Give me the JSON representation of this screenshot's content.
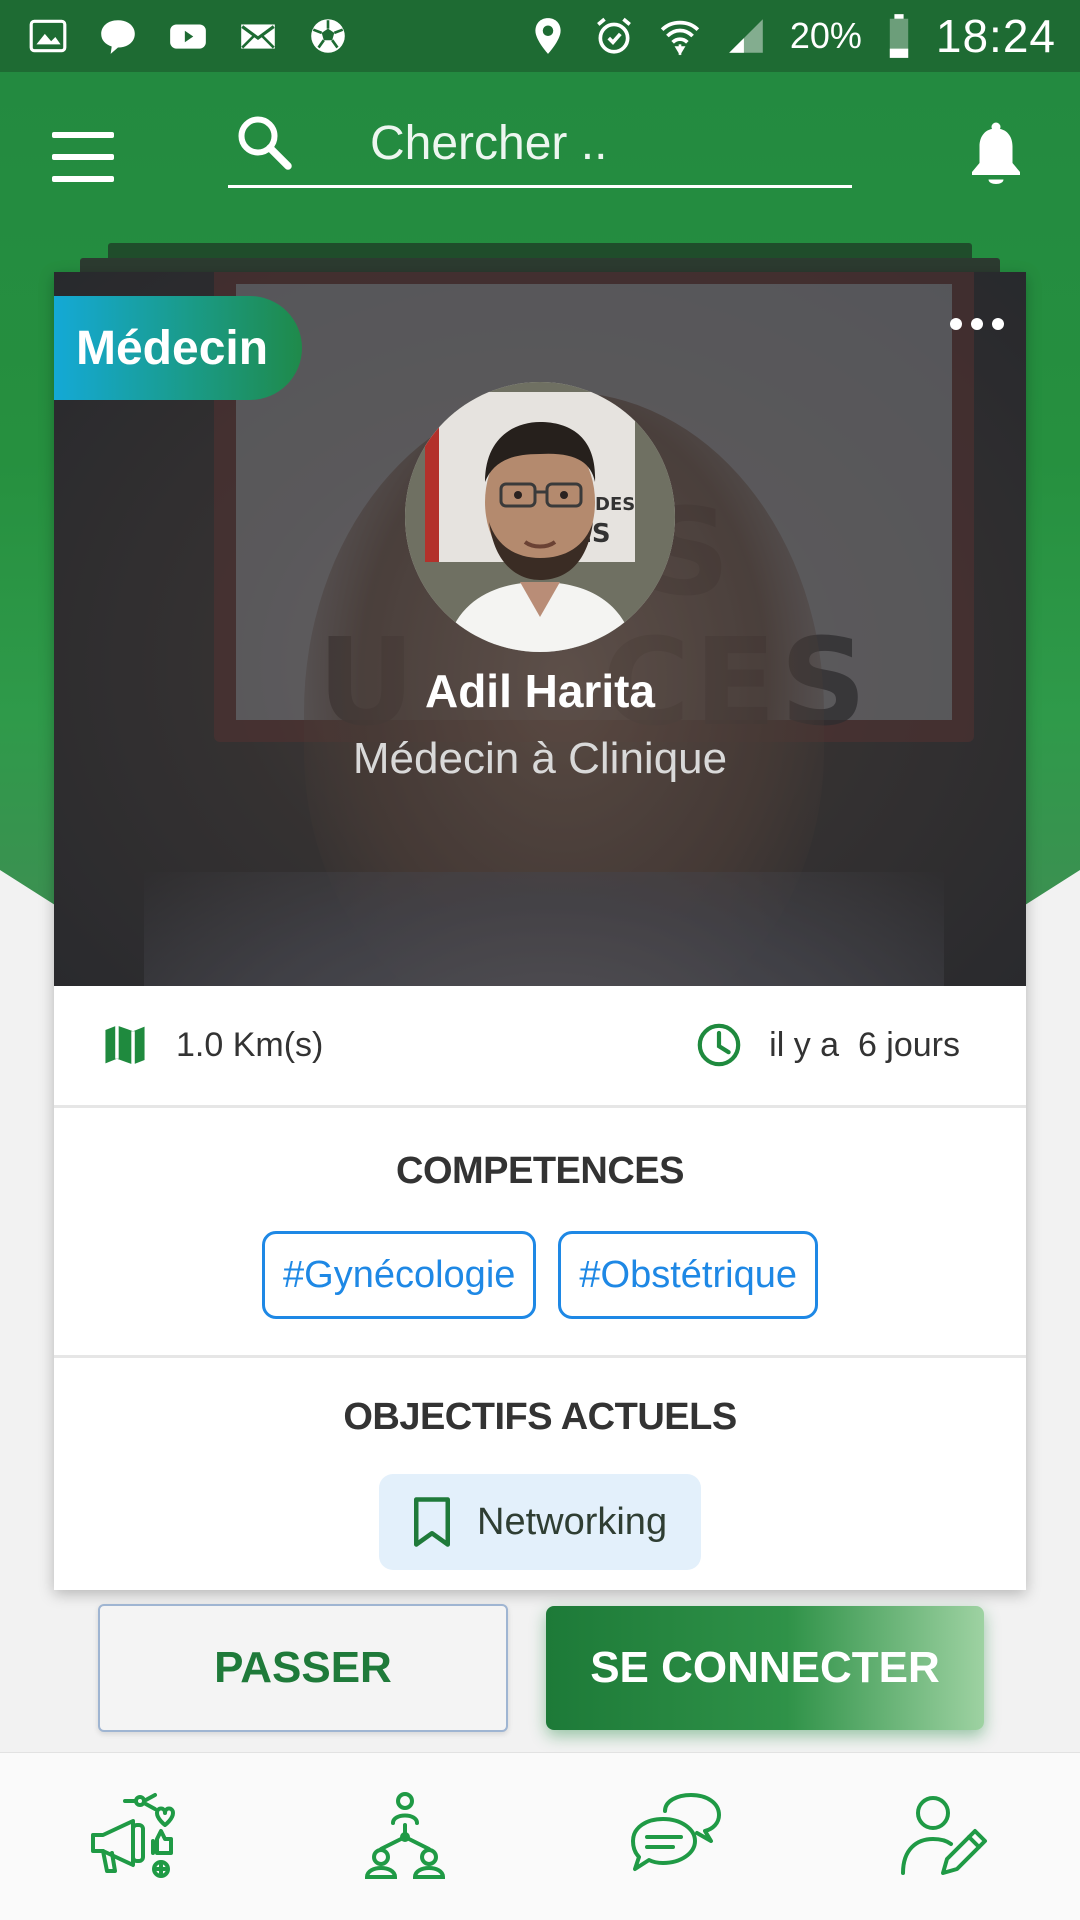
{
  "status_bar": {
    "battery": "20%",
    "time": "18:24",
    "left_icons": [
      "gallery-icon",
      "chat-bubble-icon",
      "youtube-icon",
      "mail-icon",
      "soccer-ball-icon"
    ],
    "right_icons": [
      "location-pin-icon",
      "alarm-icon",
      "wifi-icon",
      "cell-signal-icon",
      "battery-icon"
    ]
  },
  "header": {
    "search_placeholder": "Chercher ..",
    "colors": {
      "primary": "#238a40",
      "status_bar": "#1e6b33"
    }
  },
  "card": {
    "category": "Médecin",
    "name": "Adil Harita",
    "role": "Médecin à Clinique",
    "distance": "1.0 Km(s)",
    "time_ago": "il y a  6 jours",
    "skills_title": "COMPETENCES",
    "skills": [
      "#Gynécologie",
      "#Obstétrique"
    ],
    "goals_title": "OBJECTIFS ACTUELS",
    "goal": "Networking"
  },
  "actions": {
    "pass_label": "PASSER",
    "connect_label": "SE CONNECTER"
  },
  "bottom_nav": {
    "items": [
      "megaphone-social-icon",
      "network-people-icon",
      "chat-bubbles-icon",
      "edit-profile-icon"
    ]
  }
}
